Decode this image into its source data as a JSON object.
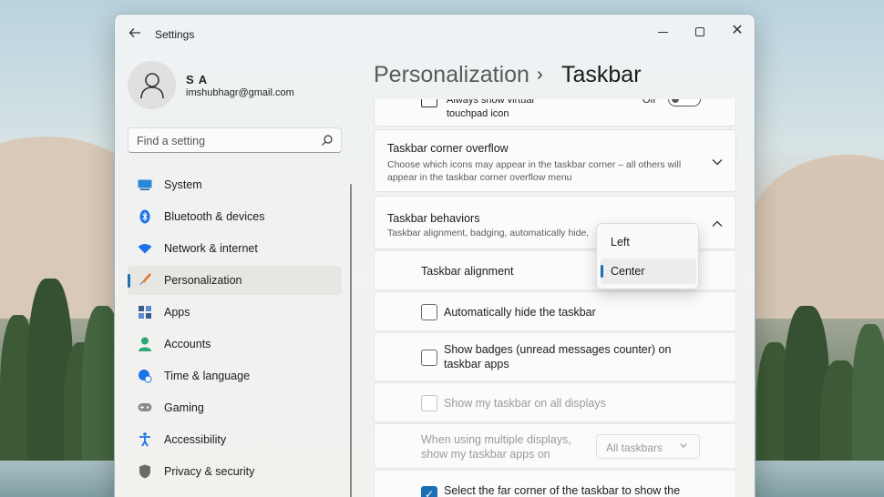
{
  "window": {
    "title": "Settings",
    "back_icon": "arrow-left-icon"
  },
  "user": {
    "name": "S A",
    "email": "imshubhagr@gmail.com"
  },
  "search": {
    "placeholder": "Find a setting"
  },
  "nav": {
    "items": [
      {
        "label": "System",
        "icon": "monitor-icon",
        "color": "#2b88d8"
      },
      {
        "label": "Bluetooth & devices",
        "icon": "bluetooth-icon",
        "color": "#1a73e8"
      },
      {
        "label": "Network & internet",
        "icon": "wifi-icon",
        "color": "#1a73e8"
      },
      {
        "label": "Personalization",
        "icon": "brush-icon",
        "color": "#e0752d",
        "active": true
      },
      {
        "label": "Apps",
        "icon": "apps-icon",
        "color": "#3b5b8c"
      },
      {
        "label": "Accounts",
        "icon": "person-icon",
        "color": "#2aa876"
      },
      {
        "label": "Time & language",
        "icon": "globe-clock-icon",
        "color": "#1a73e8"
      },
      {
        "label": "Gaming",
        "icon": "gamepad-icon",
        "color": "#7a7a7a"
      },
      {
        "label": "Accessibility",
        "icon": "accessibility-icon",
        "color": "#1a73e8"
      },
      {
        "label": "Privacy & security",
        "icon": "shield-icon",
        "color": "#6b6b6b"
      }
    ]
  },
  "breadcrumb": {
    "parent": "Personalization",
    "separator": "›",
    "current": "Taskbar"
  },
  "content": {
    "touchpad": {
      "label_line1": "Always show virtual",
      "label_line2": "touchpad icon",
      "state": "Off"
    },
    "corner_overflow": {
      "title": "Taskbar corner overflow",
      "desc_line1": "Choose which icons may appear in the taskbar corner – all others will",
      "desc_line2": "appear in the taskbar corner overflow menu"
    },
    "behaviors": {
      "title": "Taskbar behaviors",
      "desc": "Taskbar alignment, badging, automatically hide,"
    },
    "alignment": {
      "label": "Taskbar alignment",
      "options": [
        "Left",
        "Center"
      ],
      "selected": "Center"
    },
    "auto_hide": {
      "label": "Automatically hide the taskbar",
      "checked": false
    },
    "badges": {
      "label_line1": "Show badges (unread messages counter) on",
      "label_line2": "taskbar apps",
      "checked": false
    },
    "all_displays": {
      "label": "Show my taskbar on all displays",
      "checked": false,
      "disabled": true
    },
    "multi_display": {
      "label_line1": "When using multiple displays,",
      "label_line2": "show my taskbar apps on",
      "value": "All taskbars",
      "disabled": true
    },
    "far_corner": {
      "label": "Select the far corner of the taskbar to show the",
      "checked": true
    }
  }
}
